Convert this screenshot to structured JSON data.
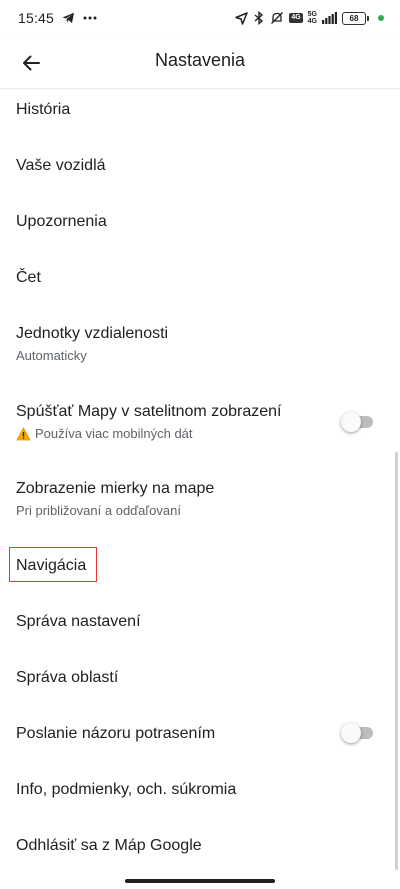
{
  "status_bar": {
    "time": "15:45",
    "network_top": "5G",
    "network_bottom": "4G",
    "volte": "4G",
    "battery": "68"
  },
  "app_bar": {
    "title": "Nastavenia"
  },
  "items": [
    {
      "title": "História"
    },
    {
      "title": "Vaše vozidlá"
    },
    {
      "title": "Upozornenia"
    },
    {
      "title": "Čet"
    },
    {
      "title": "Jednotky vzdialenosti",
      "subtitle": "Automaticky"
    },
    {
      "title": "Spúšťať Mapy v satelitnom zobrazení",
      "subtitle": "Používa viac mobilných dát",
      "toggle": false
    },
    {
      "title": "Zobrazenie mierky na mape",
      "subtitle": "Pri približovaní a odďaľovaní"
    },
    {
      "title": "Navigácia"
    },
    {
      "title": "Správa nastavení"
    },
    {
      "title": "Správa oblastí"
    },
    {
      "title": "Poslanie názoru potrasením",
      "toggle": false
    },
    {
      "title": "Info, podmienky, och. súkromia"
    },
    {
      "title": "Odhlásiť sa z Máp Google"
    }
  ],
  "colors": {
    "highlight": "#e53935",
    "charge_indicator": "#34a853",
    "toggle_off_track": "#bdbdbd"
  }
}
